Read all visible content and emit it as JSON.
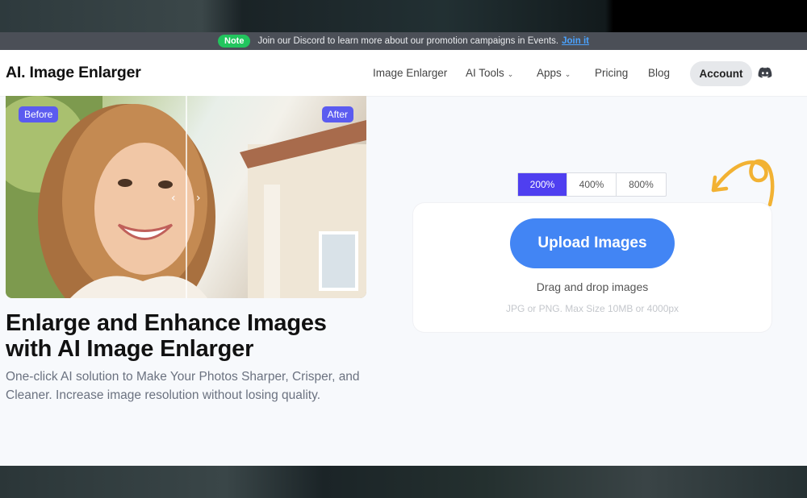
{
  "notice": {
    "badge": "Note",
    "text": "Join our Discord to learn more about our promotion campaigns in Events.",
    "link": "Join it"
  },
  "header": {
    "logo": "AI. Image Enlarger",
    "nav": [
      {
        "label": "Image Enlarger",
        "has_menu": false
      },
      {
        "label": "AI Tools",
        "has_menu": true
      },
      {
        "label": "Apps",
        "has_menu": true
      },
      {
        "label": "Pricing",
        "has_menu": false
      },
      {
        "label": "Blog",
        "has_menu": false
      }
    ],
    "account": "Account",
    "discord_icon": "discord-icon"
  },
  "hero": {
    "before": "Before",
    "after": "After",
    "title": "Enlarge and Enhance Images with AI Image Enlarger",
    "subtitle": "One-click AI solution to Make Your Photos Sharper, Crisper, and Cleaner. Increase image resolution without losing quality."
  },
  "upload": {
    "scales": [
      "200%",
      "400%",
      "800%"
    ],
    "selected_scale": "200%",
    "button": "Upload Images",
    "drag_text": "Drag and drop images",
    "hint": "JPG or PNG. Max Size 10MB or 4000px"
  },
  "colors": {
    "accent": "#4f3ff0",
    "upload_button": "#4285f4",
    "note_badge": "#22c55e",
    "arrow": "#f2b233"
  }
}
